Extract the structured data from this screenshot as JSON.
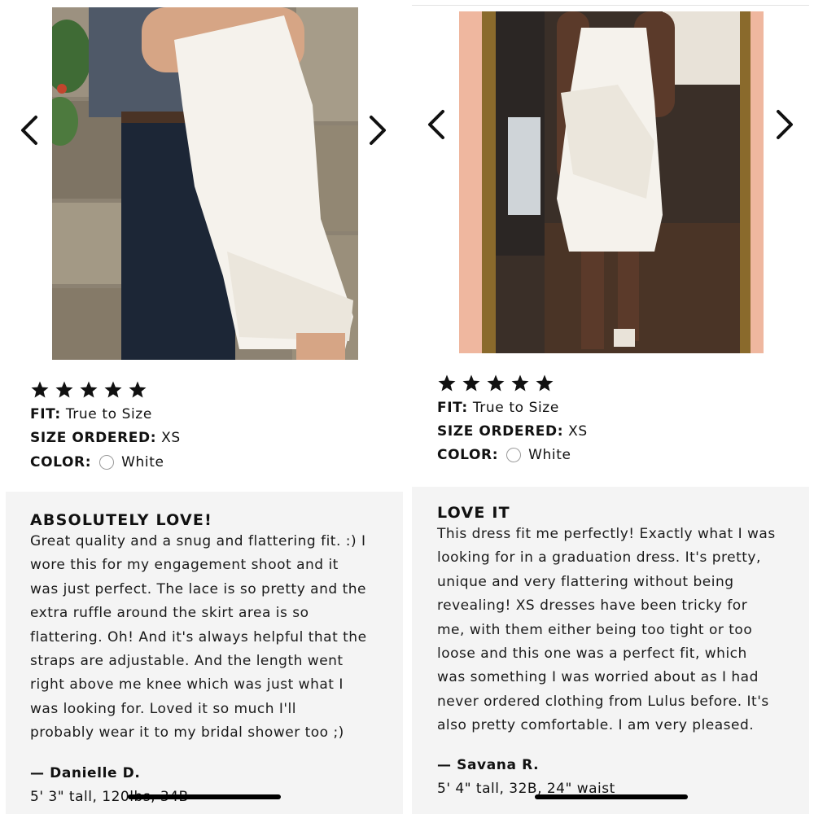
{
  "reviews": [
    {
      "rating": 5,
      "fit_label": "FIT:",
      "fit_value": "True to Size",
      "size_label": "SIZE ORDERED:",
      "size_value": "XS",
      "color_label": "COLOR:",
      "color_value": "White",
      "swatch_color": "#ffffff",
      "title": "ABSOLUTELY LOVE!",
      "body_lines": [
        "Great quality and a snug and flattering fit. :) I",
        "wore this for my engagement shoot and it",
        "was just perfect. The lace is so pretty and the",
        "extra ruffle around the skirt area is so",
        "flattering. Oh! And it's always helpful that the",
        "straps are adjustable. And the length went",
        "right above me knee which was just what I",
        "was looking for. Loved it so much I'll",
        "probably wear it to my bridal shower too ;)"
      ],
      "reviewer": "— Danielle D.",
      "reviewer_stats": "5' 3\" tall, 120lbs, 34B"
    },
    {
      "rating": 5,
      "fit_label": "FIT:",
      "fit_value": "True to Size",
      "size_label": "SIZE ORDERED:",
      "size_value": "XS",
      "color_label": "COLOR:",
      "color_value": "White",
      "swatch_color": "#ffffff",
      "title": "LOVE IT",
      "body_lines": [
        "This dress fit me perfectly! Exactly what I was",
        "looking for in a graduation dress. It's pretty,",
        "unique and very flattering without being",
        "revealing! XS dresses have been tricky for",
        "me, with them either being too tight or too",
        "loose and this one was a perfect fit, which",
        "was something I was worried about as I had",
        "never ordered clothing from Lulus before. It's",
        "also pretty comfortable. I am very pleased."
      ],
      "reviewer": "— Savana R.",
      "reviewer_stats": "5' 4\" tall, 32B, 24\" waist"
    }
  ],
  "icons": {
    "prev": "chevron-left-icon",
    "next": "chevron-right-icon",
    "star": "star-icon"
  },
  "colors": {
    "review_bg": "#f4f4f4",
    "text": "#111111",
    "dress": "#f5f2ec"
  }
}
